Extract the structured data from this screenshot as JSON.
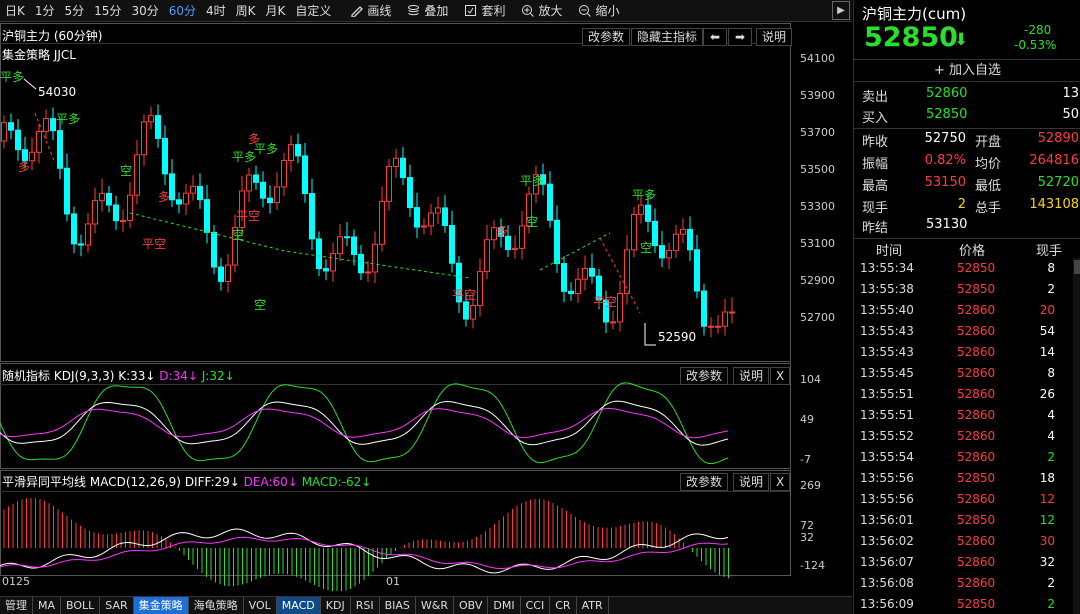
{
  "toolbar": {
    "periods": [
      "日K",
      "1分",
      "5分",
      "15分",
      "30分",
      "60分",
      "4时",
      "周K",
      "月K",
      "自定义"
    ],
    "active_period": "60分",
    "tools": [
      {
        "label": "画线",
        "icon": "pencil-icon"
      },
      {
        "label": "叠加",
        "icon": "layers-icon"
      },
      {
        "label": "套利",
        "icon": "arbitrage-icon"
      },
      {
        "label": "放大",
        "icon": "zoom-in-icon"
      },
      {
        "label": "缩小",
        "icon": "zoom-out-icon"
      }
    ],
    "expand_arrow": "▶"
  },
  "main_pane": {
    "title": "沪铜主力 (60分钟)",
    "strategy_label": "集金策略 JJCL",
    "btn_params": "改参数",
    "btn_hide": "隐藏主指标",
    "btn_prev": "⬅",
    "btn_next": "➡",
    "btn_help": "说明",
    "axis_ticks": [
      "54100",
      "53900",
      "53700",
      "53500",
      "53300",
      "53100",
      "52900",
      "52700"
    ],
    "high_label": "54030",
    "low_label": "52590",
    "signals": [
      {
        "text": "平多",
        "color": "green"
      },
      {
        "text": "多",
        "color": "red"
      },
      {
        "text": "平多",
        "color": "green"
      },
      {
        "text": "空",
        "color": "green"
      },
      {
        "text": "多",
        "color": "red"
      },
      {
        "text": "平空",
        "color": "red"
      },
      {
        "text": "多",
        "color": "red"
      },
      {
        "text": "平多",
        "color": "green"
      },
      {
        "text": "平多",
        "color": "green"
      },
      {
        "text": "平空",
        "color": "red"
      },
      {
        "text": "空",
        "color": "green"
      },
      {
        "text": "空",
        "color": "green"
      },
      {
        "text": "平空",
        "color": "red"
      },
      {
        "text": "平多",
        "color": "green"
      },
      {
        "text": "多",
        "color": "red"
      },
      {
        "text": "空",
        "color": "green"
      },
      {
        "text": "平空",
        "color": "red"
      },
      {
        "text": "平多",
        "color": "green"
      },
      {
        "text": "空",
        "color": "green"
      }
    ]
  },
  "kdj_pane": {
    "name": "随机指标",
    "params": "KDJ(9,3,3)",
    "k": "K:33↓",
    "d": "D:34↓",
    "j": "J:32↓",
    "btn_params": "改参数",
    "btn_help": "说明",
    "btn_close": "X",
    "axis_ticks": [
      "104",
      "49",
      "-7"
    ]
  },
  "macd_pane": {
    "name": "平滑异同平均线",
    "params": "MACD(12,26,9)",
    "diff": "DIFF:29↓",
    "dea": "DEA:60↓",
    "macd": "MACD:-62↓",
    "btn_params": "改参数",
    "btn_help": "说明",
    "btn_close": "X",
    "axis_ticks": [
      "269",
      "72",
      "32",
      "-124"
    ]
  },
  "x_axis": {
    "labels": [
      "0125",
      "01"
    ]
  },
  "bottom_tabs": [
    "管理",
    "MA",
    "BOLL",
    "SAR",
    "集金策略",
    "海龟策略",
    "VOL",
    "MACD",
    "KDJ",
    "RSI",
    "BIAS",
    "W&R",
    "OBV",
    "DMI",
    "CCI",
    "CR",
    "ATR"
  ],
  "active_tab": "集金策略",
  "selected_tab": "MACD",
  "right_panel": {
    "title": "沪铜主力(cum)",
    "price": "52850",
    "price_arrow": "⬇",
    "change": "-280",
    "change_pct": "-0.53%",
    "add_watch": "加入自选",
    "ask": {
      "label": "卖出",
      "price": "52860",
      "vol": "13"
    },
    "bid": {
      "label": "买入",
      "price": "52850",
      "vol": "50"
    },
    "stats": [
      {
        "l1": "昨收",
        "v1": "52750",
        "l2": "开盘",
        "v2": "52890"
      },
      {
        "l1": "振幅",
        "v1": "0.82%",
        "l2": "均价",
        "v2": "264816"
      },
      {
        "l1": "最高",
        "v1": "53150",
        "l2": "最低",
        "v2": "52720"
      },
      {
        "l1": "现手",
        "v1": "2",
        "l2": "总手",
        "v2": "143108"
      }
    ],
    "settle": {
      "label": "昨结",
      "value": "53130"
    },
    "tick_headers": [
      "时间",
      "价格",
      "现手"
    ],
    "ticks": [
      {
        "time": "13:55:34",
        "price": "52850",
        "vol": "8",
        "color": "white"
      },
      {
        "time": "13:55:38",
        "price": "52850",
        "vol": "2",
        "color": "white"
      },
      {
        "time": "13:55:40",
        "price": "52860",
        "vol": "20",
        "color": "red"
      },
      {
        "time": "13:55:43",
        "price": "52860",
        "vol": "54",
        "color": "white"
      },
      {
        "time": "13:55:43",
        "price": "52860",
        "vol": "14",
        "color": "white"
      },
      {
        "time": "13:55:45",
        "price": "52860",
        "vol": "8",
        "color": "white"
      },
      {
        "time": "13:55:51",
        "price": "52860",
        "vol": "26",
        "color": "white"
      },
      {
        "time": "13:55:51",
        "price": "52860",
        "vol": "4",
        "color": "white"
      },
      {
        "time": "13:55:52",
        "price": "52860",
        "vol": "4",
        "color": "white"
      },
      {
        "time": "13:55:54",
        "price": "52860",
        "vol": "2",
        "color": "green"
      },
      {
        "time": "13:55:56",
        "price": "52850",
        "vol": "18",
        "color": "white"
      },
      {
        "time": "13:55:56",
        "price": "52860",
        "vol": "12",
        "color": "red"
      },
      {
        "time": "13:56:01",
        "price": "52850",
        "vol": "12",
        "color": "green"
      },
      {
        "time": "13:56:02",
        "price": "52860",
        "vol": "30",
        "color": "red"
      },
      {
        "time": "13:56:07",
        "price": "52860",
        "vol": "32",
        "color": "white"
      },
      {
        "time": "13:56:08",
        "price": "52860",
        "vol": "2",
        "color": "white"
      },
      {
        "time": "13:56:09",
        "price": "52850",
        "vol": "2",
        "color": "green"
      }
    ]
  },
  "colors": {
    "up": "#ff3b3b",
    "down": "#00ffff",
    "green": "#28e028",
    "kdj_k": "#ffffff",
    "kdj_d": "#ff33ff",
    "kdj_j": "#28e028",
    "macd_diff": "#ffffff",
    "macd_dea": "#ff33ff",
    "accent": "#1b6fd8"
  }
}
